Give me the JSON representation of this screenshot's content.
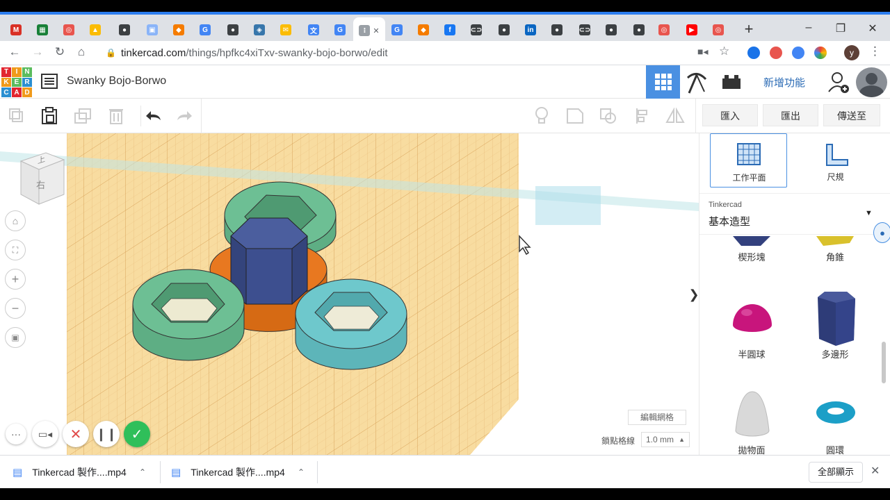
{
  "browser": {
    "tabs": [
      {
        "icon": "gmail-icon",
        "color": "#d93025",
        "glyph": "M"
      },
      {
        "icon": "sheets-icon",
        "color": "#188038",
        "glyph": "▦"
      },
      {
        "icon": "autodesk-icon",
        "color": "#e8554e",
        "glyph": "◎"
      },
      {
        "icon": "drive-icon",
        "color": "#fbbc04",
        "glyph": "▲"
      },
      {
        "icon": "site-icon",
        "color": "#3c4043",
        "glyph": "●"
      },
      {
        "icon": "page-icon",
        "color": "#8ab4f8",
        "glyph": "▣"
      },
      {
        "icon": "tinkercad-icon",
        "color": "#f57c00",
        "glyph": "◆"
      },
      {
        "icon": "google-icon",
        "color": "#4285f4",
        "glyph": "G"
      },
      {
        "icon": "site-icon",
        "color": "#3c4043",
        "glyph": "●"
      },
      {
        "icon": "python-icon",
        "color": "#3776ab",
        "glyph": "◈"
      },
      {
        "icon": "mail-icon",
        "color": "#fbbc04",
        "glyph": "✉"
      },
      {
        "icon": "translate-icon",
        "color": "#4285f4",
        "glyph": "文"
      },
      {
        "icon": "google-icon",
        "color": "#4285f4",
        "glyph": "G"
      },
      {
        "icon": "active-tab-icon",
        "color": "#9aa0a6",
        "glyph": "⁝"
      },
      {
        "icon": "google-icon",
        "color": "#4285f4",
        "glyph": "G"
      },
      {
        "icon": "tinkercad-icon",
        "color": "#f57c00",
        "glyph": "◆"
      },
      {
        "icon": "facebook-icon",
        "color": "#1877f2",
        "glyph": "f"
      },
      {
        "icon": "link-icon",
        "color": "#3c4043",
        "glyph": "⊂⊃"
      },
      {
        "icon": "site-icon",
        "color": "#3c4043",
        "glyph": "●"
      },
      {
        "icon": "linkedin-icon",
        "color": "#0a66c2",
        "glyph": "in"
      },
      {
        "icon": "site-icon",
        "color": "#3c4043",
        "glyph": "●"
      },
      {
        "icon": "link-icon",
        "color": "#3c4043",
        "glyph": "⊂⊃"
      },
      {
        "icon": "site-icon",
        "color": "#3c4043",
        "glyph": "●"
      },
      {
        "icon": "site-icon",
        "color": "#3c4043",
        "glyph": "●"
      },
      {
        "icon": "autodesk-icon",
        "color": "#e8554e",
        "glyph": "◎"
      },
      {
        "icon": "youtube-icon",
        "color": "#ff0000",
        "glyph": "▶"
      },
      {
        "icon": "autodesk-icon",
        "color": "#e8554e",
        "glyph": "◎"
      }
    ],
    "url_host": "tinkercad.com",
    "url_path": "/things/hpfkc4xiTxv-swanky-bojo-borwo/edit",
    "profile_initial": "y"
  },
  "app": {
    "logo_letters": [
      "T",
      "I",
      "N",
      "K",
      "E",
      "R",
      "C",
      "A",
      "D"
    ],
    "logo_colors": [
      "#e2252f",
      "#f09a1b",
      "#5bbc5e",
      "#f09a1b",
      "#5bbc5e",
      "#2b8fd1",
      "#2b8fd1",
      "#e2252f",
      "#f09a1b"
    ],
    "doc_title": "Swanky Bojo-Borwo",
    "new_features": "新增功能",
    "import": "匯入",
    "export": "匯出",
    "send_to": "傳送至"
  },
  "viewcube": {
    "top": "上",
    "right": "右"
  },
  "panel": {
    "workplane": "工作平面",
    "ruler": "尺規",
    "library_source": "Tinkercad",
    "library_name": "基本造型",
    "shapes": [
      {
        "label": "楔形塊"
      },
      {
        "label": "角錐"
      },
      {
        "label": "半圓球"
      },
      {
        "label": "多邊形"
      },
      {
        "label": "拋物面"
      },
      {
        "label": "圓環"
      }
    ]
  },
  "grid": {
    "edit_grid": "編輯網格",
    "snap_label": "鎖點格線",
    "snap_value": "1.0 mm"
  },
  "downloads": {
    "items": [
      {
        "name": "Tinkercad 製作....mp4"
      },
      {
        "name": "Tinkercad 製作....mp4"
      }
    ],
    "show_all": "全部顯示"
  },
  "colors": {
    "green_ring": "#6dbf94",
    "teal_ring": "#6ec8cc",
    "orange_base": "#e87820",
    "hex_prism": "#3d4f8f",
    "workplane": "#f8dca0",
    "accent": "#2d7ef0"
  }
}
